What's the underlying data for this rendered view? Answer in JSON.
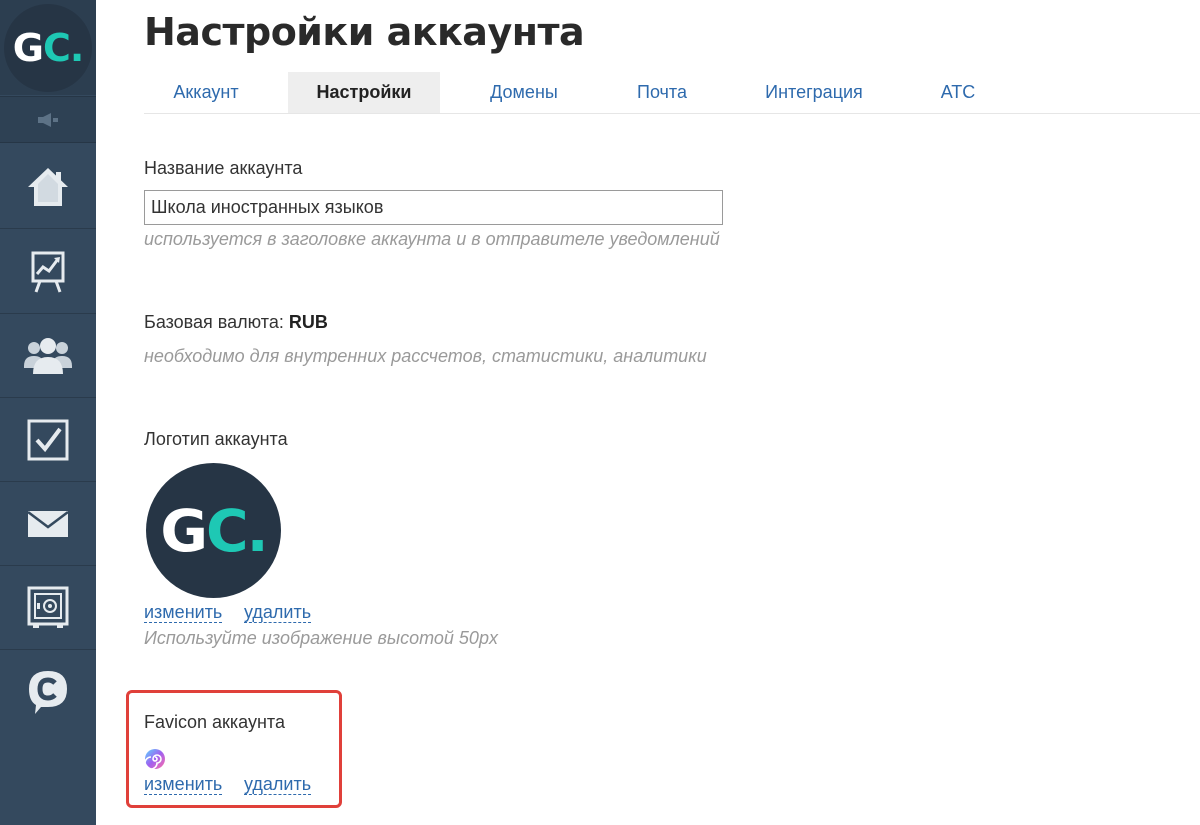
{
  "sidebar": {
    "logo": {
      "letter_g": "G",
      "letter_c": "C",
      "dot": "."
    },
    "collapse_icon": "speaker-icon",
    "items": [
      {
        "icon": "home-icon"
      },
      {
        "icon": "chart-icon"
      },
      {
        "icon": "users-icon"
      },
      {
        "icon": "checkbox-icon"
      },
      {
        "icon": "mail-icon"
      },
      {
        "icon": "safe-icon"
      },
      {
        "icon": "chat-icon"
      }
    ]
  },
  "header": {
    "title": "Настройки аккаунта",
    "tabs": [
      {
        "label": "Аккаунт",
        "active": false
      },
      {
        "label": "Настройки",
        "active": true
      },
      {
        "label": "Домены",
        "active": false
      },
      {
        "label": "Почта",
        "active": false
      },
      {
        "label": "Интеграция",
        "active": false
      },
      {
        "label": "АТС",
        "active": false
      }
    ]
  },
  "settings": {
    "account_name": {
      "label": "Название аккаунта",
      "value": "Школа иностранных языков",
      "hint": "используется в заголовке аккаунта и в отправителе уведомлений"
    },
    "currency": {
      "label": "Базовая валюта:",
      "value": "RUB",
      "hint": "необходимо для внутренних рассчетов, статистики, аналитики"
    },
    "logo": {
      "label": "Логотип аккаунта",
      "image_text_g": "G",
      "image_text_c": "C.",
      "change_link": "изменить",
      "delete_link": "удалить",
      "hint": "Используйте изображение высотой 50px"
    },
    "favicon": {
      "label": "Favicon аккаунта",
      "icon": "spiral-favicon-icon",
      "change_link": "изменить",
      "delete_link": "удалить"
    }
  },
  "colors": {
    "sidebar_bg": "#34495e",
    "brand_teal": "#1ec8b4",
    "link_blue": "#2e6aad",
    "highlight_red": "#e0403a"
  }
}
